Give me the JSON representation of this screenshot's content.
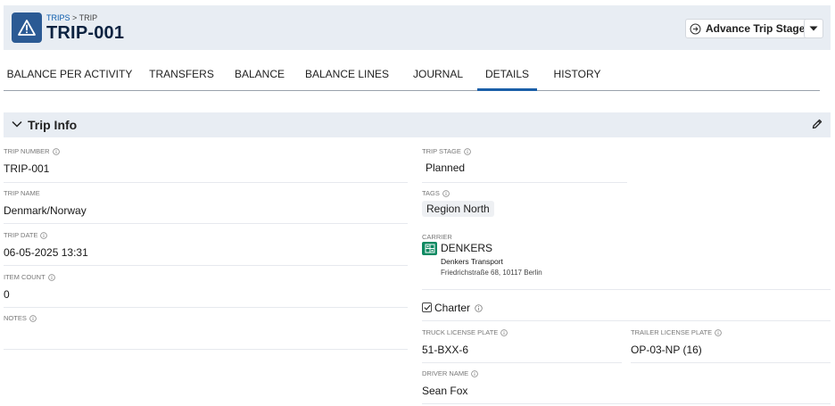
{
  "header": {
    "breadcrumb_parent": "TRIPS",
    "breadcrumb_sep": ">",
    "breadcrumb_current": "TRIP",
    "title": "TRIP-001",
    "advance_button": "Advance Trip Stage",
    "icons": {
      "app": "warning-triangle-icon",
      "advance": "arrow-circle-right-icon",
      "dropdown": "caret-down-icon"
    }
  },
  "tabs": [
    {
      "label": "BALANCE PER ACTIVITY",
      "active": false
    },
    {
      "label": "TRANSFERS",
      "active": false
    },
    {
      "label": "BALANCE",
      "active": false
    },
    {
      "label": "BALANCE LINES",
      "active": false
    },
    {
      "label": "JOURNAL",
      "active": false
    },
    {
      "label": "DETAILS",
      "active": true
    },
    {
      "label": "HISTORY",
      "active": false
    }
  ],
  "section": {
    "title": "Trip Info"
  },
  "fields": {
    "trip_number": {
      "label": "TRIP NUMBER",
      "value": "TRIP-001"
    },
    "trip_name": {
      "label": "TRIP NAME",
      "value": "Denmark/Norway"
    },
    "trip_date": {
      "label": "TRIP DATE",
      "value": "06-05-2025 13:31"
    },
    "item_count": {
      "label": "ITEM COUNT",
      "value": "0"
    },
    "notes": {
      "label": "NOTES",
      "value": ""
    },
    "trip_stage": {
      "label": "TRIP STAGE",
      "value": "Planned"
    },
    "tags": {
      "label": "TAGS",
      "items": [
        "Region North"
      ]
    },
    "carrier": {
      "label": "CARRIER",
      "name": "DENKERS",
      "company": "Denkers Transport",
      "address": "Friedrichstraße 68, 10117 Berlin"
    },
    "charter": {
      "label": "Charter",
      "checked": true
    },
    "truck_license_plate": {
      "label": "TRUCK LICENSE PLATE",
      "value": "51-BXX-6"
    },
    "trailer_license_plate": {
      "label": "TRAILER LICENSE PLATE",
      "value": "OP-03-NP (16)"
    },
    "driver_name": {
      "label": "DRIVER NAME",
      "value": "Sean Fox"
    }
  },
  "colors": {
    "accent": "#1b5fa8",
    "header_bg": "#e8edf3",
    "app_icon": "#2b5a94",
    "carrier_logo": "#0e8a62"
  }
}
